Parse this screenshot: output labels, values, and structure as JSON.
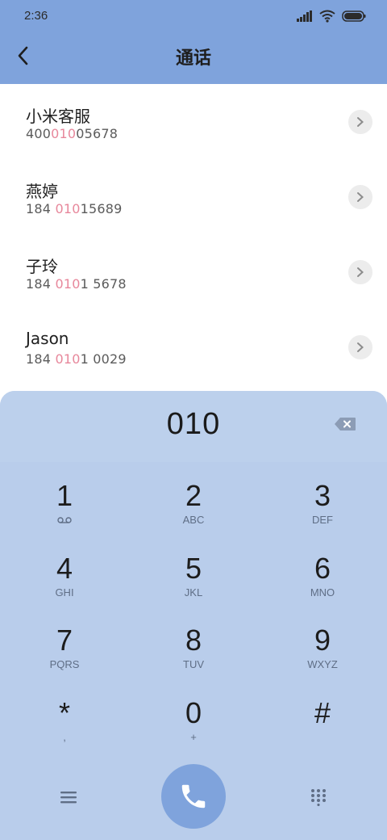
{
  "status": {
    "time": "2:36"
  },
  "header": {
    "title": "通话"
  },
  "contacts": [
    {
      "name": "小米客服",
      "num_pre": "400",
      "num_hl": "010",
      "num_post": "05678"
    },
    {
      "name": "燕婷",
      "num_pre": "184 ",
      "num_hl": "010",
      "num_post": "15689"
    },
    {
      "name": "子玲",
      "num_pre": "184 ",
      "num_hl": "010",
      "num_post": "1 5678"
    },
    {
      "name": "Jason",
      "num_pre": "184 ",
      "num_hl": "010",
      "num_post": "1 0029"
    }
  ],
  "dialer": {
    "input": "010",
    "keys": [
      {
        "digit": "1",
        "letters": ""
      },
      {
        "digit": "2",
        "letters": "ABC"
      },
      {
        "digit": "3",
        "letters": "DEF"
      },
      {
        "digit": "4",
        "letters": "GHI"
      },
      {
        "digit": "5",
        "letters": "JKL"
      },
      {
        "digit": "6",
        "letters": "MNO"
      },
      {
        "digit": "7",
        "letters": "PQRS"
      },
      {
        "digit": "8",
        "letters": "TUV"
      },
      {
        "digit": "9",
        "letters": "WXYZ"
      },
      {
        "digit": "*",
        "letters": ","
      },
      {
        "digit": "0",
        "letters": "+"
      },
      {
        "digit": "#",
        "letters": ""
      }
    ]
  },
  "colors": {
    "accent": "#7fa3dc",
    "pad_bg": "#b9cdeb",
    "highlight": "#e7879b"
  },
  "icons": [
    "back-arrow-icon",
    "chevron-right-icon",
    "backspace-icon",
    "voicemail-icon",
    "menu-icon",
    "phone-icon",
    "keypad-grid-icon",
    "signal-icon",
    "wifi-icon",
    "battery-icon"
  ]
}
